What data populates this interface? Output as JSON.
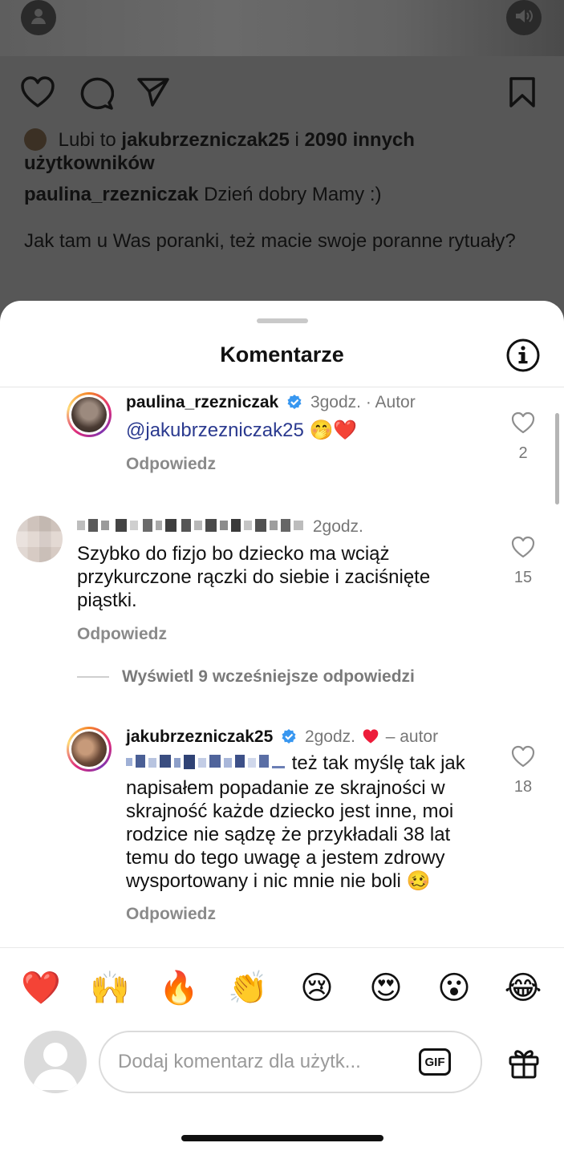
{
  "post": {
    "likes_prefix": "Lubi to",
    "likes_user": "jakubrzezniczak25",
    "likes_join": "i",
    "likes_others": "2090 innych użytkowników",
    "caption_user": "paulina_rzezniczak",
    "caption_line1": "Dzień dobry Mamy :)",
    "caption_line2": "Jak tam u Was poranki, też macie swoje poranne rytuały?"
  },
  "sheet": {
    "title": "Komentarze"
  },
  "comments": [
    {
      "username": "paulina_rzezniczak",
      "time": "3godz.",
      "sep": "·",
      "tag": "Autor",
      "mention": "@jakubrzezniczak25",
      "emojis": "🤭❤️",
      "reply": "Odpowiedz",
      "likes": "2"
    },
    {
      "time": "2godz.",
      "text": "Szybko do fizjo bo dziecko ma wciąż przykurczone rączki do siebie i zaciśnięte piąstki.",
      "reply": "Odpowiedz",
      "likes": "15"
    },
    {
      "username": "jakubrzezniczak25",
      "time": "2godz.",
      "tag": "– autor",
      "text": "też tak myślę tak jak napisałem popadanie ze skrajności w skrajność każde dziecko jest inne, moi rodzice nie sądzę że przykładali 38 lat temu do tego uwagę a jestem zdrowy wysportowany i nic mnie nie boli",
      "emoji": "🥴",
      "reply": "Odpowiedz",
      "likes": "18"
    }
  ],
  "view_more": "Wyświetl 9 wcześniejsze odpowiedzi",
  "emojis": [
    "❤️",
    "🙌",
    "🔥",
    "👏",
    "😢",
    "😍",
    "😮",
    "😂"
  ],
  "composer": {
    "placeholder": "Dodaj komentarz dla użytk...",
    "gif_label": "GIF"
  },
  "colors": {
    "verified": "#3897f0",
    "heart": "#ed1c3a",
    "dim_overlay": "#575757"
  }
}
